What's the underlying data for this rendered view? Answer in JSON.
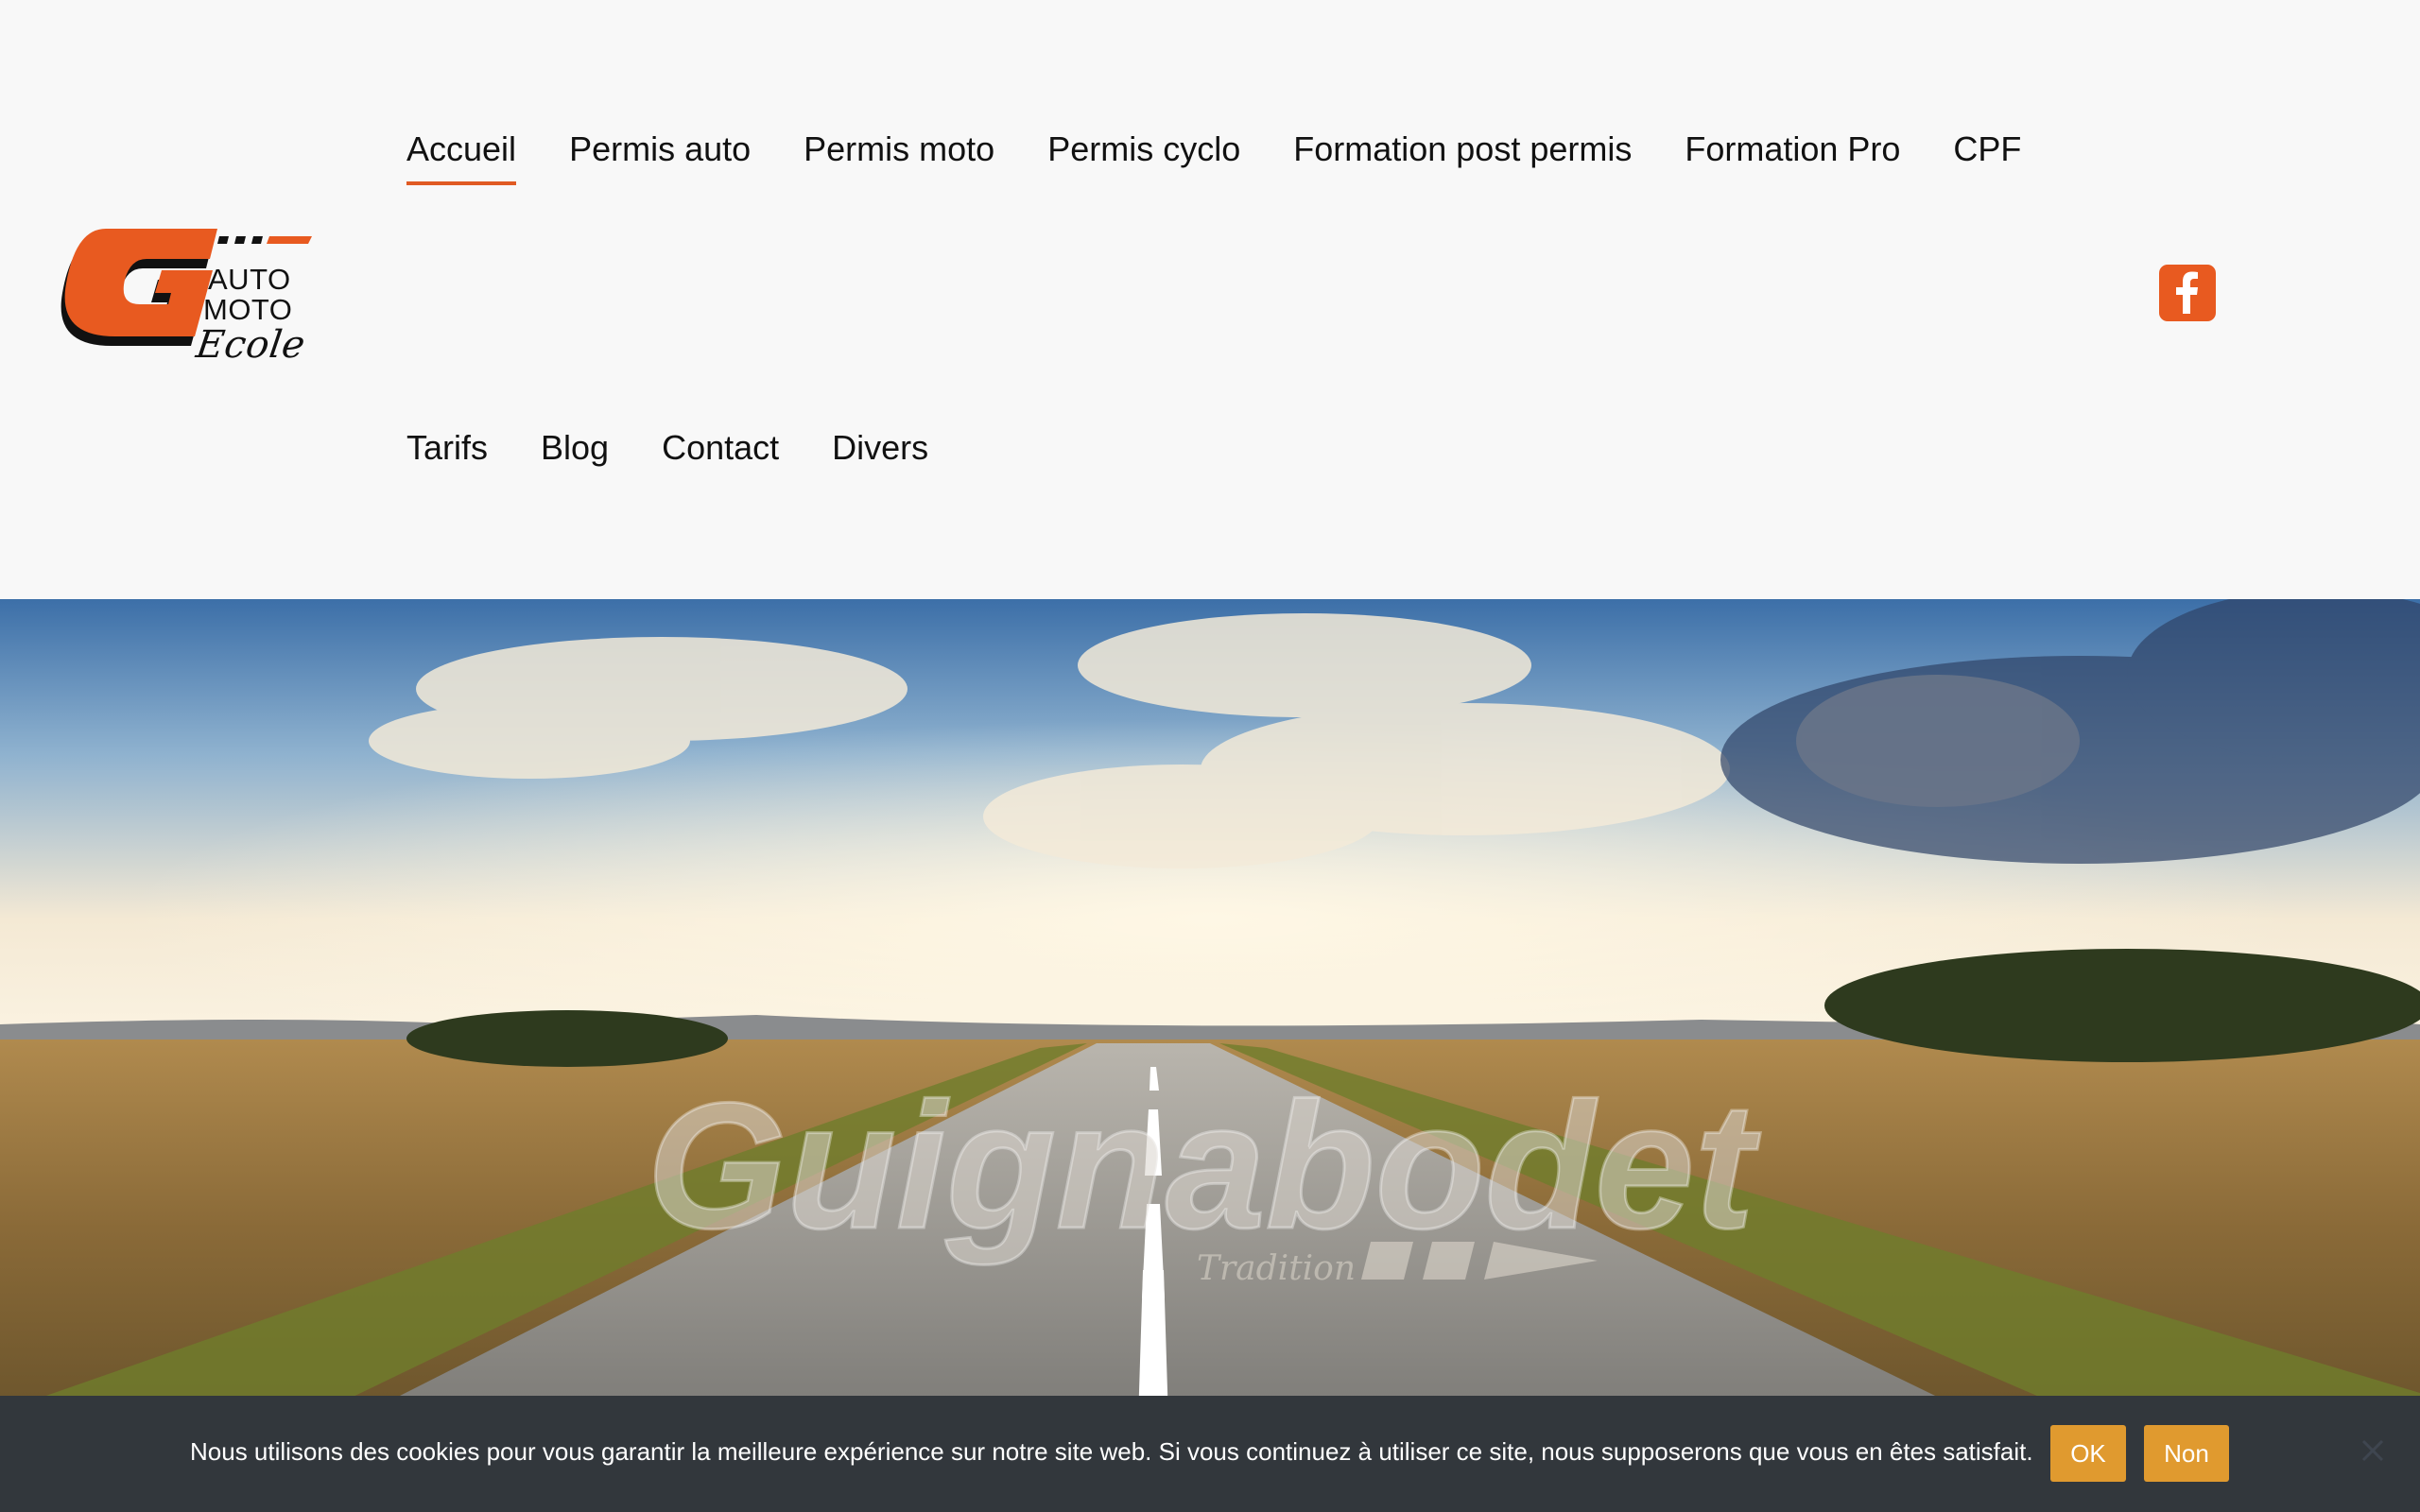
{
  "logo": {
    "words": [
      "AUTO",
      "MOTO",
      "Ecole"
    ],
    "letter": "G"
  },
  "nav": {
    "row1": [
      {
        "label": "Accueil",
        "active": true
      },
      {
        "label": "Permis auto"
      },
      {
        "label": "Permis moto"
      },
      {
        "label": "Permis cyclo"
      },
      {
        "label": "Formation post permis"
      },
      {
        "label": "Formation Pro"
      },
      {
        "label": "CPF"
      }
    ],
    "row2": [
      {
        "label": "Tarifs"
      },
      {
        "label": "Blog"
      },
      {
        "label": "Contact"
      },
      {
        "label": "Divers"
      }
    ]
  },
  "social": {
    "icon": "facebook-icon"
  },
  "hero": {
    "watermark": "Guignabodet",
    "watermark_sub": "Tradition"
  },
  "cookie": {
    "text": "Nous utilisons des cookies pour vous garantir la meilleure expérience sur notre site web. Si vous continuez à utiliser ce site, nous supposerons que vous en êtes satisfait.",
    "ok_label": "OK",
    "no_label": "Non"
  },
  "colors": {
    "accent": "#e85a20",
    "cookie_bg": "#32373c",
    "cookie_btn": "#e09a2f"
  }
}
